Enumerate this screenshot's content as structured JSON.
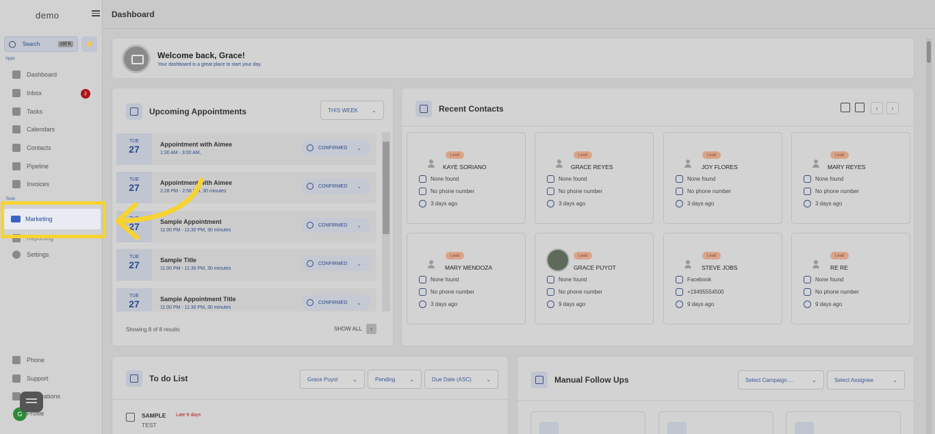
{
  "app": {
    "logo": "demo",
    "page_title": "Dashboard"
  },
  "sidebar": {
    "search_label": "Search",
    "search_shortcut": "ctrl K",
    "apps_label": "Apps",
    "tools_label": "Tools",
    "items": [
      {
        "label": "Dashboard",
        "icon": "dashboard-icon"
      },
      {
        "label": "Inbox",
        "icon": "inbox-icon",
        "badge": "2"
      },
      {
        "label": "Tasks",
        "icon": "tasks-icon"
      },
      {
        "label": "Calendars",
        "icon": "calendar-icon"
      },
      {
        "label": "Contacts",
        "icon": "contacts-icon"
      },
      {
        "label": "Pipeline",
        "icon": "pipeline-icon"
      },
      {
        "label": "Invoices",
        "icon": "invoice-icon"
      },
      {
        "label": "Marketing",
        "icon": "megaphone-icon"
      },
      {
        "label": "Reporting",
        "icon": "reporting-icon"
      },
      {
        "label": "Settings",
        "icon": "gear-icon"
      }
    ],
    "bottom": [
      {
        "label": "Phone",
        "icon": "phone-icon"
      },
      {
        "label": "Support",
        "icon": "support-icon"
      },
      {
        "label": "Notifications",
        "icon": "bell-icon"
      },
      {
        "label": "Profile",
        "icon": "profile-icon",
        "avatar": "G"
      }
    ]
  },
  "welcome": {
    "title": "Welcome back, Grace!",
    "subtitle": "Your dashboard is a great place to start your day."
  },
  "appointments": {
    "title": "Upcoming Appointments",
    "filter": "THIS WEEK",
    "items": [
      {
        "day": "TUE",
        "date": "27",
        "title": "Appointment with Aimee",
        "time": "1:30 AM - 3:00 AM,",
        "status": "CONFIRMED"
      },
      {
        "day": "TUE",
        "date": "27",
        "title": "Appointment with Aimee",
        "time": "2:28 PM - 2:58 PM, 30 minutes",
        "status": "CONFIRMED"
      },
      {
        "day": "TUE",
        "date": "27",
        "title": "Sample Appointment",
        "time": "11:00 PM - 11:30 PM, 30 minutes",
        "status": "CONFIRMED"
      },
      {
        "day": "TUE",
        "date": "27",
        "title": "Sample Title",
        "time": "11:00 PM - 11:30 PM, 30 minutes",
        "status": "CONFIRMED"
      },
      {
        "day": "TUE",
        "date": "27",
        "title": "Sample Appointment Title",
        "time": "11:00 PM - 11:30 PM, 30 minutes",
        "status": "CONFIRMED"
      }
    ],
    "footer": "Showing 8 of 8 results",
    "show_all": "SHOW ALL"
  },
  "contacts": {
    "title": "Recent Contacts",
    "badge": "Lead",
    "items": [
      {
        "name": "KAYE SORIANO",
        "company": "None found",
        "phone": "No phone number",
        "ago": "3 days ago"
      },
      {
        "name": "GRACE REYES",
        "company": "None found",
        "phone": "No phone number",
        "ago": "3 days ago"
      },
      {
        "name": "JOY FLORES",
        "company": "None found",
        "phone": "No phone number",
        "ago": "3 days ago"
      },
      {
        "name": "MARY REYES",
        "company": "None found",
        "phone": "No phone number",
        "ago": "3 days ago"
      },
      {
        "name": "MARY MENDOZA",
        "company": "None found",
        "phone": "No phone number",
        "ago": "3 days ago"
      },
      {
        "name": "GRACE PUYOT",
        "company": "None found",
        "phone": "No phone number",
        "ago": "9 days ago"
      },
      {
        "name": "STEVE JOBS",
        "company": "Facebook",
        "phone": "+19495554500",
        "ago": "9 days ago"
      },
      {
        "name": "RE RE",
        "company": "None found",
        "phone": "No phone number",
        "ago": "9 days ago"
      }
    ]
  },
  "todo": {
    "title": "To do List",
    "filters": [
      "Grace Puyot",
      "Pending",
      "Due Date (ASC)"
    ],
    "item_title": "SAMPLE",
    "item_late": "Late 6 days",
    "item_sub": "TEST"
  },
  "followups": {
    "title": "Manual Follow Ups",
    "filters": [
      "Select Campaign ...",
      "Select Assignee"
    ]
  },
  "colors": {
    "highlight": "#f6d332",
    "accent": "#2b4a8a",
    "badge_red": "#b0131c",
    "lead_badge": "#d7a58a"
  }
}
